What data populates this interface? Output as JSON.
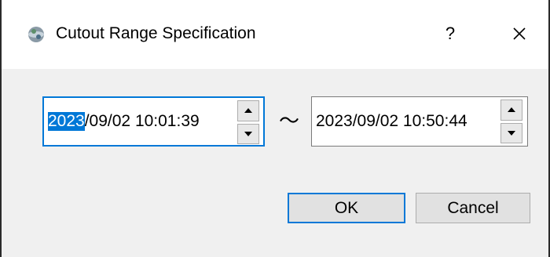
{
  "window": {
    "title": "Cutout Range Specification",
    "help_label": "?",
    "icon": "globe-app-icon",
    "close_icon": "close-icon"
  },
  "range": {
    "start": {
      "year": "2023",
      "rest": "/09/02 10:01:39"
    },
    "separator": "～",
    "end": {
      "value": "2023/09/02 10:50:44"
    }
  },
  "buttons": {
    "ok_label": "OK",
    "cancel_label": "Cancel"
  },
  "colors": {
    "accent": "#0078d7",
    "selection": "#0078d7",
    "dialog_bg": "#f0f0f0"
  }
}
